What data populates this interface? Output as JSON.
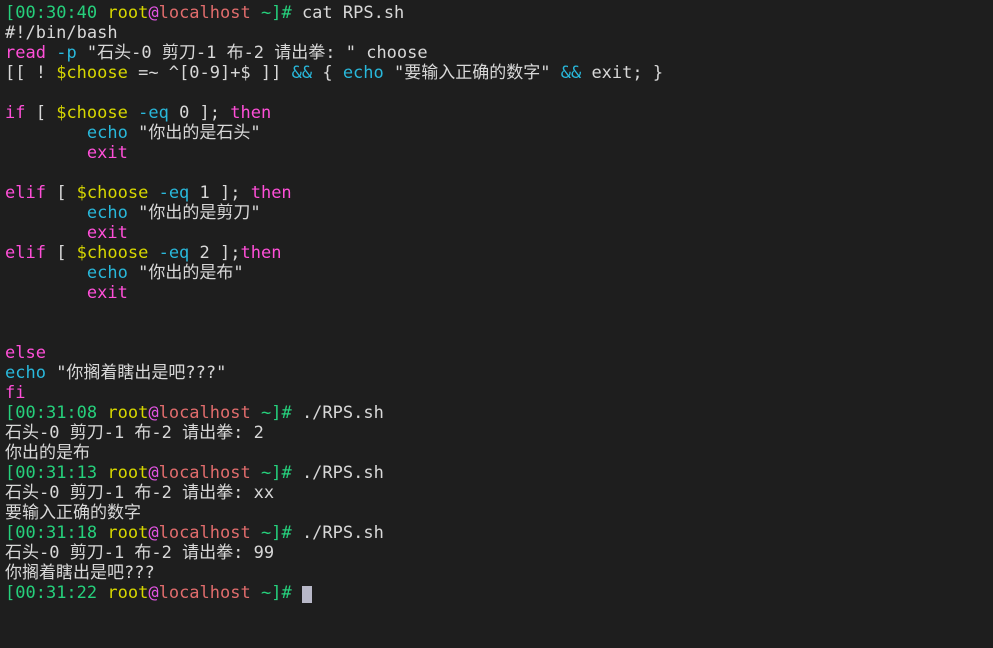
{
  "terminal": {
    "background_color": "#1e1e1e",
    "foreground_color": "#d8d8d8",
    "cursor_color": "#b8b8c8",
    "palette": {
      "green": "#26d07c",
      "yellow": "#d7d700",
      "magenta": "#e455e4",
      "red": "#e06c6c",
      "cyan": "#29b8db",
      "pink": "#ff4fd8",
      "white": "#d8d8d8"
    },
    "prompt": {
      "open_bracket": "[",
      "user": "root",
      "at": "@",
      "host": "localhost",
      "space": " ",
      "cwd": "~",
      "close": "]#",
      "trailing_space": " "
    },
    "lines": [
      {
        "type": "prompt",
        "time": "00:30:40",
        "command": " cat RPS.sh"
      },
      {
        "type": "code",
        "segments": [
          {
            "text": "#!/bin/bash",
            "color": "white"
          }
        ]
      },
      {
        "type": "code",
        "segments": [
          {
            "text": "read",
            "color": "pink"
          },
          {
            "text": " ",
            "color": "white"
          },
          {
            "text": "-p",
            "color": "cyan"
          },
          {
            "text": " \"石头-0 剪刀-1 布-2 请出拳: \" choose",
            "color": "white"
          }
        ]
      },
      {
        "type": "code",
        "segments": [
          {
            "text": "[[ ! ",
            "color": "white"
          },
          {
            "text": "$choose",
            "color": "yellow"
          },
          {
            "text": " =~ ^[0-9]+$ ]] ",
            "color": "white"
          },
          {
            "text": "&&",
            "color": "cyan"
          },
          {
            "text": " { ",
            "color": "white"
          },
          {
            "text": "echo",
            "color": "cyan"
          },
          {
            "text": " \"要输入正确的数字\" ",
            "color": "white"
          },
          {
            "text": "&&",
            "color": "cyan"
          },
          {
            "text": " exit; }",
            "color": "white"
          }
        ]
      },
      {
        "type": "code",
        "segments": [
          {
            "text": "",
            "color": "white"
          }
        ]
      },
      {
        "type": "code",
        "segments": [
          {
            "text": "if",
            "color": "pink"
          },
          {
            "text": " [ ",
            "color": "white"
          },
          {
            "text": "$choose",
            "color": "yellow"
          },
          {
            "text": " ",
            "color": "white"
          },
          {
            "text": "-eq",
            "color": "cyan"
          },
          {
            "text": " 0 ]; ",
            "color": "white"
          },
          {
            "text": "then",
            "color": "pink"
          }
        ]
      },
      {
        "type": "code",
        "segments": [
          {
            "text": "        ",
            "color": "white"
          },
          {
            "text": "echo",
            "color": "cyan"
          },
          {
            "text": " \"你出的是石头\"",
            "color": "white"
          }
        ]
      },
      {
        "type": "code",
        "segments": [
          {
            "text": "        ",
            "color": "white"
          },
          {
            "text": "exit",
            "color": "pink"
          }
        ]
      },
      {
        "type": "code",
        "segments": [
          {
            "text": "",
            "color": "white"
          }
        ]
      },
      {
        "type": "code",
        "segments": [
          {
            "text": "elif",
            "color": "pink"
          },
          {
            "text": " [ ",
            "color": "white"
          },
          {
            "text": "$choose",
            "color": "yellow"
          },
          {
            "text": " ",
            "color": "white"
          },
          {
            "text": "-eq",
            "color": "cyan"
          },
          {
            "text": " 1 ]; ",
            "color": "white"
          },
          {
            "text": "then",
            "color": "pink"
          }
        ]
      },
      {
        "type": "code",
        "segments": [
          {
            "text": "        ",
            "color": "white"
          },
          {
            "text": "echo",
            "color": "cyan"
          },
          {
            "text": " \"你出的是剪刀\"",
            "color": "white"
          }
        ]
      },
      {
        "type": "code",
        "segments": [
          {
            "text": "        ",
            "color": "white"
          },
          {
            "text": "exit",
            "color": "pink"
          }
        ]
      },
      {
        "type": "code",
        "segments": [
          {
            "text": "elif",
            "color": "pink"
          },
          {
            "text": " [ ",
            "color": "white"
          },
          {
            "text": "$choose",
            "color": "yellow"
          },
          {
            "text": " ",
            "color": "white"
          },
          {
            "text": "-eq",
            "color": "cyan"
          },
          {
            "text": " 2 ];",
            "color": "white"
          },
          {
            "text": "then",
            "color": "pink"
          }
        ]
      },
      {
        "type": "code",
        "segments": [
          {
            "text": "        ",
            "color": "white"
          },
          {
            "text": "echo",
            "color": "cyan"
          },
          {
            "text": " \"你出的是布\"",
            "color": "white"
          }
        ]
      },
      {
        "type": "code",
        "segments": [
          {
            "text": "        ",
            "color": "white"
          },
          {
            "text": "exit",
            "color": "pink"
          }
        ]
      },
      {
        "type": "code",
        "segments": [
          {
            "text": "",
            "color": "white"
          }
        ]
      },
      {
        "type": "code",
        "segments": [
          {
            "text": "",
            "color": "white"
          }
        ]
      },
      {
        "type": "code",
        "segments": [
          {
            "text": "else",
            "color": "pink"
          }
        ]
      },
      {
        "type": "code",
        "segments": [
          {
            "text": "echo",
            "color": "cyan"
          },
          {
            "text": " \"你搁着瞎出是吧???\"",
            "color": "white"
          }
        ]
      },
      {
        "type": "code",
        "segments": [
          {
            "text": "fi",
            "color": "pink"
          }
        ]
      },
      {
        "type": "prompt",
        "time": "00:31:08",
        "command": " ./RPS.sh"
      },
      {
        "type": "output",
        "segments": [
          {
            "text": "石头-0 剪刀-1 布-2 请出拳: 2",
            "color": "white"
          }
        ]
      },
      {
        "type": "output",
        "segments": [
          {
            "text": "你出的是布",
            "color": "white"
          }
        ]
      },
      {
        "type": "prompt",
        "time": "00:31:13",
        "command": " ./RPS.sh"
      },
      {
        "type": "output",
        "segments": [
          {
            "text": "石头-0 剪刀-1 布-2 请出拳: xx",
            "color": "white"
          }
        ]
      },
      {
        "type": "output",
        "segments": [
          {
            "text": "要输入正确的数字",
            "color": "white"
          }
        ]
      },
      {
        "type": "prompt",
        "time": "00:31:18",
        "command": " ./RPS.sh"
      },
      {
        "type": "output",
        "segments": [
          {
            "text": "石头-0 剪刀-1 布-2 请出拳: 99",
            "color": "white"
          }
        ]
      },
      {
        "type": "output",
        "segments": [
          {
            "text": "你搁着瞎出是吧???",
            "color": "white"
          }
        ]
      },
      {
        "type": "prompt",
        "time": "00:31:22",
        "command": " ",
        "cursor": true
      }
    ]
  }
}
